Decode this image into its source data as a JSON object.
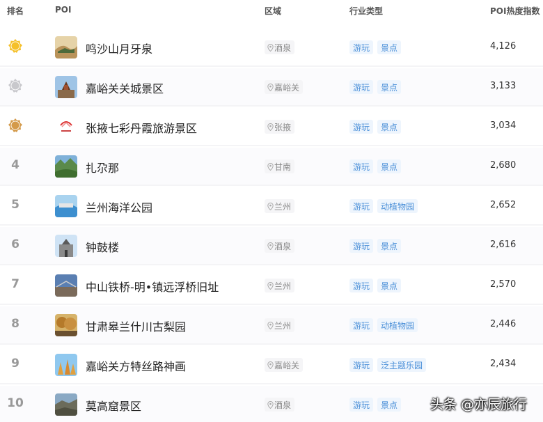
{
  "header": {
    "rank": "排名",
    "poi": "POI",
    "region": "区域",
    "industry": "行业类型",
    "heat": "POI热度指数"
  },
  "rows": [
    {
      "rank": "1",
      "name": "鸣沙山月牙泉",
      "region": "酒泉",
      "tag1": "游玩",
      "tag2": "景点",
      "heat": "4,126"
    },
    {
      "rank": "2",
      "name": "嘉峪关关城景区",
      "region": "嘉峪关",
      "tag1": "游玩",
      "tag2": "景点",
      "heat": "3,133"
    },
    {
      "rank": "3",
      "name": "张掖七彩丹霞旅游景区",
      "region": "张掖",
      "tag1": "游玩",
      "tag2": "景点",
      "heat": "3,034"
    },
    {
      "rank": "4",
      "name": "扎尕那",
      "region": "甘南",
      "tag1": "游玩",
      "tag2": "景点",
      "heat": "2,680"
    },
    {
      "rank": "5",
      "name": "兰州海洋公园",
      "region": "兰州",
      "tag1": "游玩",
      "tag2": "动植物园",
      "heat": "2,652"
    },
    {
      "rank": "6",
      "name": "钟鼓楼",
      "region": "酒泉",
      "tag1": "游玩",
      "tag2": "景点",
      "heat": "2,616"
    },
    {
      "rank": "7",
      "name": "中山铁桥-明•镇远浮桥旧址",
      "region": "兰州",
      "tag1": "游玩",
      "tag2": "景点",
      "heat": "2,570"
    },
    {
      "rank": "8",
      "name": "甘肃皋兰什川古梨园",
      "region": "兰州",
      "tag1": "游玩",
      "tag2": "动植物园",
      "heat": "2,446"
    },
    {
      "rank": "9",
      "name": "嘉峪关方特丝路神画",
      "region": "嘉峪关",
      "tag1": "游玩",
      "tag2": "泛主题乐园",
      "heat": "2,434"
    },
    {
      "rank": "10",
      "name": "莫高窟景区",
      "region": "酒泉",
      "tag1": "游玩",
      "tag2": "景点",
      "heat": ""
    }
  ],
  "watermark": "头条 @亦辰旅行",
  "colors": {
    "gold": "#f5c02a",
    "silver": "#c8c8cc",
    "bronze": "#d49a4a",
    "tag_bg": "#eef5fd",
    "tag_text": "#4a8fd8"
  },
  "icons": {
    "region": "location-pin-icon",
    "medal": "medal-icon"
  }
}
